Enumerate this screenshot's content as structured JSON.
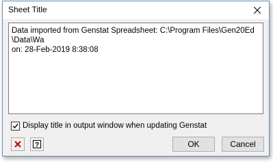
{
  "window": {
    "title": "Sheet Title",
    "close_icon": "close-icon"
  },
  "sheet_title": {
    "value": "Data imported from Genstat Spreadsheet: C:\\Program Files\\Gen20Ed\\Data\\Wa\non: 28-Feb-2019 8:38:08"
  },
  "options": {
    "display_title_label": "Display title in output window when updating Genstat",
    "display_title_checked": true
  },
  "toolbar": {
    "clear_icon": "clear-icon",
    "help_icon": "help-icon",
    "ok_label": "OK",
    "cancel_label": "Cancel"
  },
  "colors": {
    "clear_icon": "#c00000",
    "dialog_background": "#f0f0f0",
    "border_accent": "#6b8fb5"
  }
}
